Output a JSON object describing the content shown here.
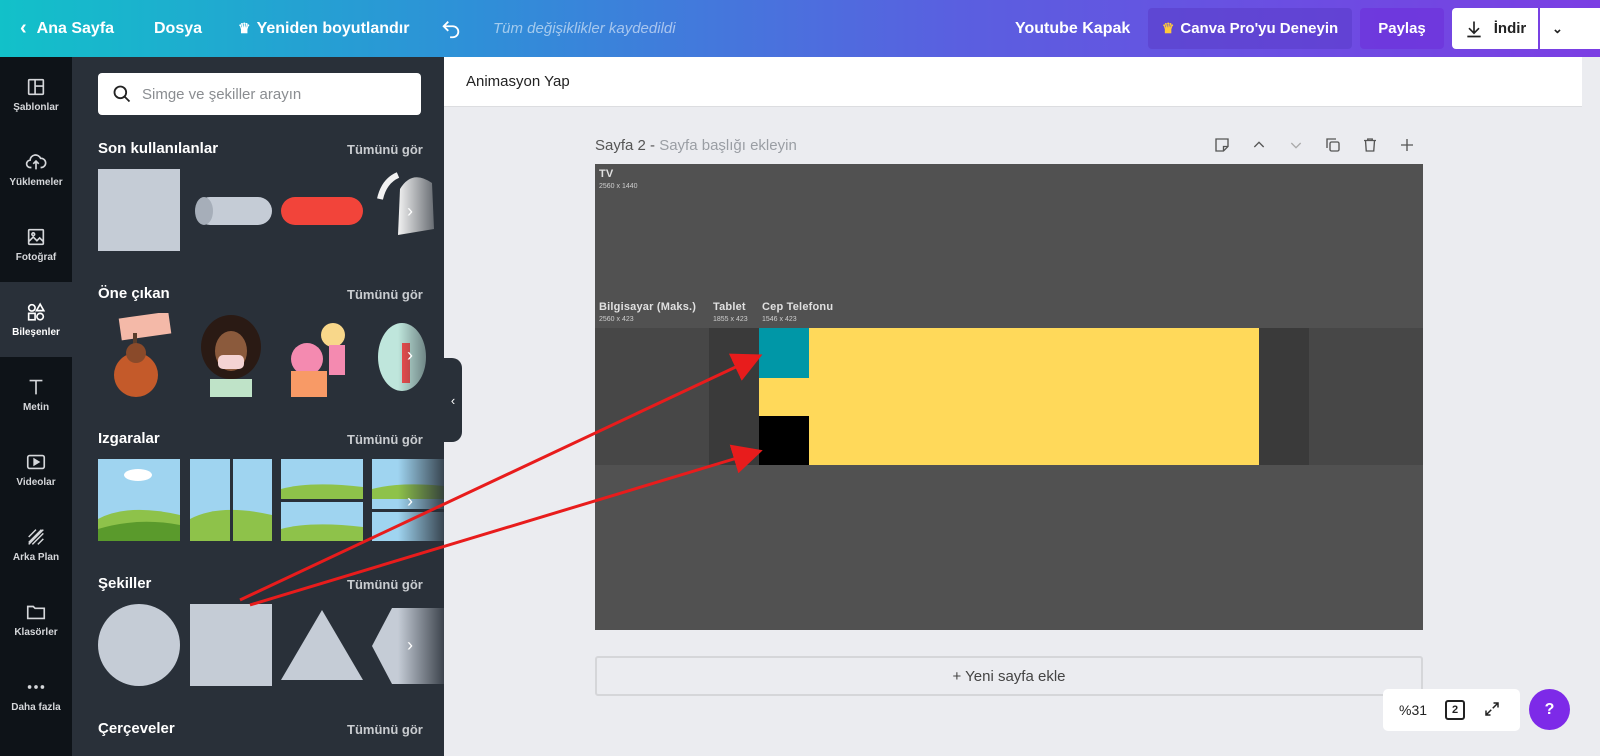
{
  "topbar": {
    "home": "Ana Sayfa",
    "file": "Dosya",
    "resize": "Yeniden boyutlandır",
    "saved_status": "Tüm değişiklikler kaydedildi",
    "doc_title": "Youtube Kapak",
    "pro": "Canva Pro'yu Deneyin",
    "share": "Paylaş",
    "download": "İndir"
  },
  "rail": [
    {
      "label": "Şablonlar",
      "icon": "templates-icon"
    },
    {
      "label": "Yüklemeler",
      "icon": "upload-icon"
    },
    {
      "label": "Fotoğraf",
      "icon": "photo-icon"
    },
    {
      "label": "Bileşenler",
      "icon": "elements-icon"
    },
    {
      "label": "Metin",
      "icon": "text-icon"
    },
    {
      "label": "Videolar",
      "icon": "video-icon"
    },
    {
      "label": "Arka Plan",
      "icon": "background-icon"
    },
    {
      "label": "Klasörler",
      "icon": "folder-icon"
    },
    {
      "label": "Daha fazla",
      "icon": "more-icon"
    }
  ],
  "panel": {
    "search_placeholder": "Simge ve şekiller arayın",
    "see_all": "Tümünü gör",
    "sections": {
      "recent": "Son kullanılanlar",
      "featured": "Öne çıkan",
      "grids": "Izgaralar",
      "shapes": "Şekiller",
      "frames": "Çerçeveler"
    }
  },
  "subbar": {
    "animate": "Animasyon Yap"
  },
  "page": {
    "label": "Sayfa 2 -",
    "title_placeholder": "Sayfa başlığı ekleyin"
  },
  "canvas": {
    "zones": {
      "tv": {
        "label": "TV",
        "size": "2560 x 1440"
      },
      "desktop": {
        "label": "Bilgisayar (Maks.)",
        "size": "2560 x 423"
      },
      "tablet": {
        "label": "Tablet",
        "size": "1855 x 423"
      },
      "phone": {
        "label": "Cep Telefonu",
        "size": "1546 x 423"
      }
    },
    "colors": {
      "teal": "#0097a7",
      "yellow": "#ffd95a",
      "black": "#000000",
      "arrow": "#e81c1c"
    }
  },
  "add_page": "+ Yeni sayfa ekle",
  "zoom": "%31",
  "page_count": "2",
  "help": "?"
}
